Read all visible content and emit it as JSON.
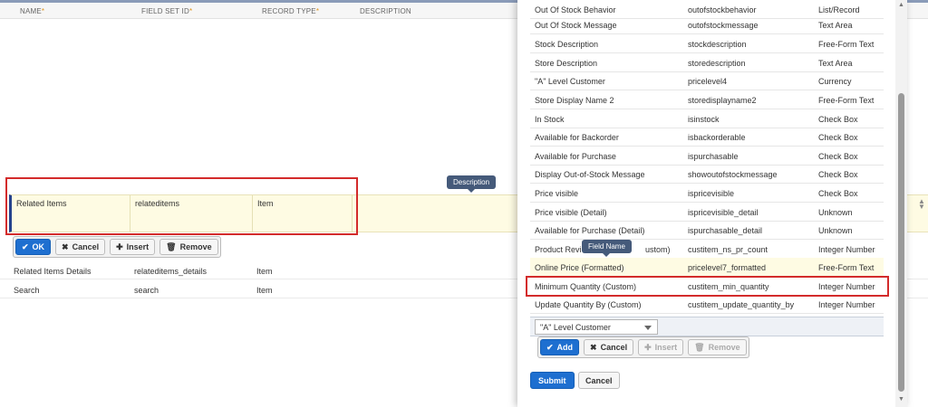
{
  "header": {
    "cols": [
      "NAME",
      "FIELD SET ID",
      "RECORD TYPE",
      "DESCRIPTION"
    ],
    "required_mark": "*"
  },
  "edit_row": {
    "name": "Related Items",
    "id": "relateditems",
    "type": "Item"
  },
  "row_buttons": {
    "ok": "OK",
    "cancel": "Cancel",
    "insert": "Insert",
    "remove": "Remove"
  },
  "rows": [
    {
      "name": "Related Items Details",
      "id": "relateditems_details",
      "type": "Item"
    },
    {
      "name": "Search",
      "id": "search",
      "type": "Item"
    }
  ],
  "tooltips": {
    "description": "Description",
    "field_name": "Field Name"
  },
  "popup": {
    "fields": [
      {
        "label": "Out Of Stock Behavior",
        "id": "outofstockbehavior",
        "type": "List/Record"
      },
      {
        "label": "Out Of Stock Message",
        "id": "outofstockmessage",
        "type": "Text Area"
      },
      {
        "label": "Stock Description",
        "id": "stockdescription",
        "type": "Free-Form Text"
      },
      {
        "label": "Store Description",
        "id": "storedescription",
        "type": "Text Area"
      },
      {
        "label": "\"A\" Level Customer",
        "id": "pricelevel4",
        "type": "Currency"
      },
      {
        "label": "Store Display Name 2",
        "id": "storedisplayname2",
        "type": "Free-Form Text"
      },
      {
        "label": "In Stock",
        "id": "isinstock",
        "type": "Check Box"
      },
      {
        "label": "Available for Backorder",
        "id": "isbackorderable",
        "type": "Check Box"
      },
      {
        "label": "Available for Purchase",
        "id": "ispurchasable",
        "type": "Check Box"
      },
      {
        "label": "Display Out-of-Stock Message",
        "id": "showoutofstockmessage",
        "type": "Check Box"
      },
      {
        "label": "Price visible",
        "id": "ispricevisible",
        "type": "Check Box"
      },
      {
        "label": "Price visible (Detail)",
        "id": "ispricevisible_detail",
        "type": "Unknown"
      },
      {
        "label": "Available for Purchase (Detail)",
        "id": "ispurchasable_detail",
        "type": "Unknown"
      },
      {
        "label": "Product Revi",
        "label_end": "ustom)",
        "id": "custitem_ns_pr_count",
        "type": "Integer Number"
      },
      {
        "label": "Online Price (Formatted)",
        "id": "pricelevel7_formatted",
        "type": "Free-Form Text"
      },
      {
        "label": "Minimum Quantity (Custom)",
        "id": "custitem_min_quantity",
        "type": "Integer Number"
      },
      {
        "label": "Update Quantity By (Custom)",
        "id": "custitem_update_quantity_by",
        "type": "Integer Number"
      }
    ],
    "select_value": "\"A\" Level Customer",
    "buttons": {
      "add": "Add",
      "cancel": "Cancel",
      "insert": "Insert",
      "remove": "Remove"
    },
    "submit": "Submit",
    "cancel": "Cancel"
  },
  "colors": {
    "accent": "#1e6fd0",
    "highlight_box": "#d32b2b",
    "edit_row_bg": "#fefbe3"
  }
}
